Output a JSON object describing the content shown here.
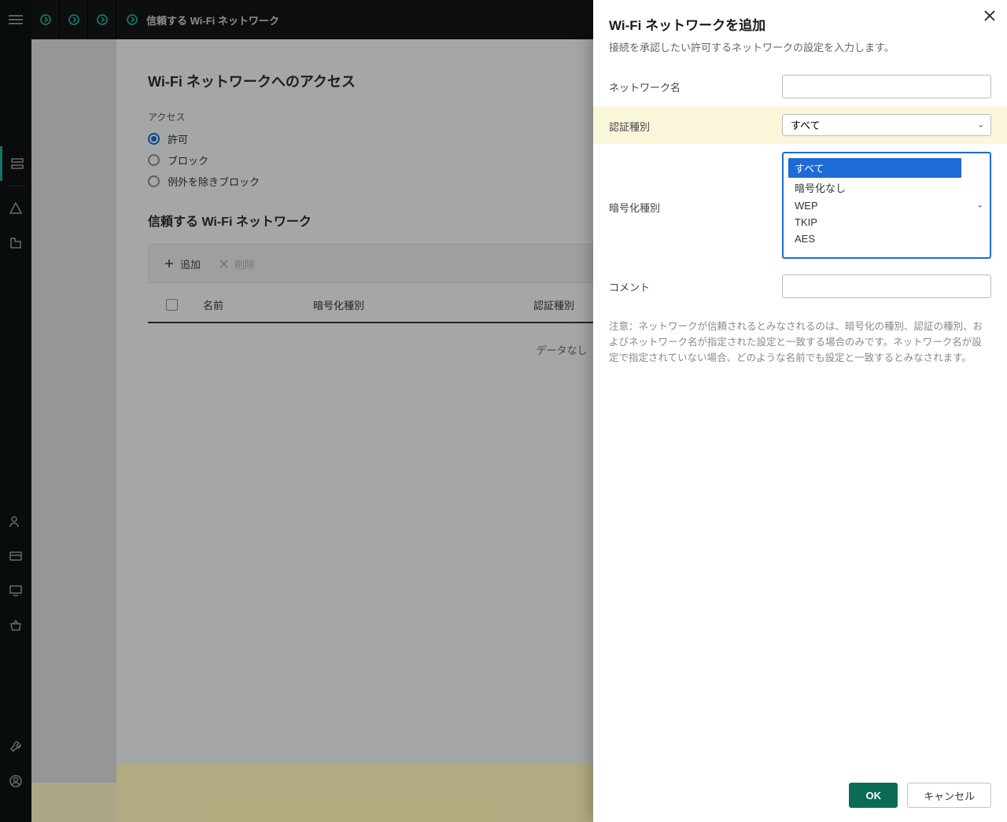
{
  "topbar": {
    "title": "信頼する Wi-Fi ネットワーク"
  },
  "main": {
    "h1": "Wi-Fi ネットワークへのアクセス",
    "access_label": "アクセス",
    "radios": {
      "allow": "許可",
      "block": "ブロック",
      "block_except": "例外を除きブロック"
    },
    "h2": "信頼する Wi-Fi ネットワーク",
    "toolbar": {
      "add": "追加",
      "delete": "削除"
    },
    "table": {
      "col_name": "名前",
      "col_encryption": "暗号化種別",
      "col_auth": "認証種別",
      "no_data": "データなし"
    }
  },
  "panel": {
    "title": "Wi-Fi ネットワークを追加",
    "subtitle": "接続を承認したい許可するネットワークの設定を入力します。",
    "labels": {
      "network_name": "ネットワーク名",
      "auth_type": "認証種別",
      "enc_type": "暗号化種別",
      "comment": "コメント"
    },
    "auth_selected": "すべて",
    "enc_options": [
      "すべて",
      "暗号化なし",
      "WEP",
      "TKIP",
      "AES"
    ],
    "note": "注意：ネットワークが信頼されるとみなされるのは、暗号化の種別、認証の種別、およびネットワーク名が指定された設定と一致する場合のみです。ネットワーク名が設定で指定されていない場合、どのような名前でも設定と一致するとみなされます。",
    "ok": "OK",
    "cancel": "キャンセル"
  }
}
